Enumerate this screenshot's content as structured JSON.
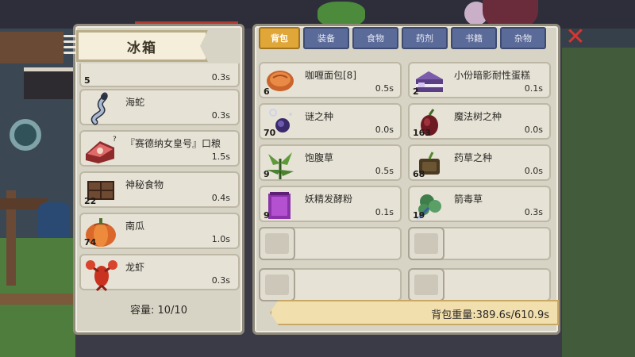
{
  "fridge": {
    "title": "冰箱",
    "capacity_label": "容量: 10/10",
    "items": [
      {
        "name": "",
        "count": "5",
        "time": "0.3s",
        "icon": "partial-item-icon"
      },
      {
        "name": "海蛇",
        "count": "",
        "time": "0.3s",
        "icon": "sea-snake-icon"
      },
      {
        "name": "『赛德纳女皇号』口粮",
        "count": "",
        "time": "1.5s",
        "icon": "meat-ration-icon"
      },
      {
        "name": "神秘食物",
        "count": "22",
        "time": "0.4s",
        "icon": "chocolate-bar-icon"
      },
      {
        "name": "南瓜",
        "count": "74",
        "time": "1.0s",
        "icon": "pumpkin-icon"
      },
      {
        "name": "龙虾",
        "count": "",
        "time": "0.3s",
        "icon": "lobster-icon"
      }
    ]
  },
  "bag": {
    "tabs": [
      {
        "label": "背包",
        "active": true
      },
      {
        "label": "装备",
        "active": false
      },
      {
        "label": "食物",
        "active": false
      },
      {
        "label": "药剂",
        "active": false
      },
      {
        "label": "书籍",
        "active": false
      },
      {
        "label": "杂物",
        "active": false
      }
    ],
    "items": [
      {
        "name": "咖喱面包[8]",
        "count": "6",
        "time": "0.5s",
        "icon": "curry-bread-icon"
      },
      {
        "name": "小份暗影耐性蛋糕",
        "count": "2",
        "time": "0.1s",
        "icon": "shadow-cake-icon"
      },
      {
        "name": "谜之种",
        "count": "70",
        "time": "0.0s",
        "icon": "mystery-seed-icon"
      },
      {
        "name": "魔法树之种",
        "count": "163",
        "time": "0.0s",
        "icon": "magic-tree-seed-icon"
      },
      {
        "name": "饱腹草",
        "count": "9",
        "time": "0.5s",
        "icon": "satiety-herb-icon"
      },
      {
        "name": "药草之种",
        "count": "68",
        "time": "0.0s",
        "icon": "herb-seed-icon"
      },
      {
        "name": "妖精发酵粉",
        "count": "9",
        "time": "0.1s",
        "icon": "fairy-powder-icon"
      },
      {
        "name": "箭毒草",
        "count": "19",
        "time": "0.3s",
        "icon": "arrow-poison-herb-icon"
      }
    ],
    "weight_label": "背包重量:389.6s/610.9s"
  },
  "close_label": "✕",
  "colors": {
    "panel": "#d8d4c5",
    "tab_active": "#e0a637",
    "tab_inactive": "#5a6a99",
    "close": "#d9352f",
    "weight_bar": "#f2dfae"
  }
}
